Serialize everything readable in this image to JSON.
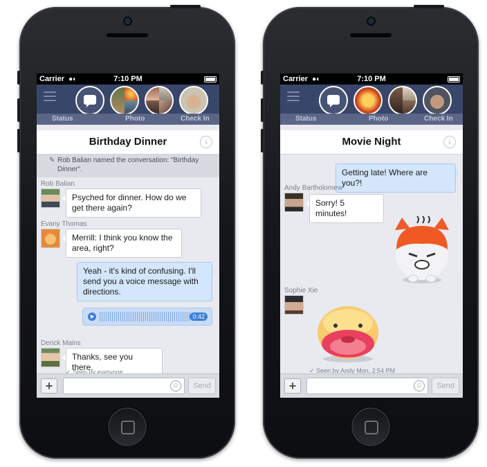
{
  "status_bar": {
    "carrier": "Carrier",
    "time": "7:10 PM"
  },
  "fb_bar": {
    "status": "Status",
    "photo": "Photo",
    "check_in": "Check In"
  },
  "composer": {
    "send": "Send",
    "plus": "+"
  },
  "left_phone": {
    "title": "Birthday Dinner",
    "notice": "Rob Balian named the conversation: \"Birthday Dinner\".",
    "messages": [
      {
        "sender": "Rob Balian",
        "text": "Psyched for dinner. How do we get there again?"
      },
      {
        "sender": "Evany Thomas",
        "text": "Merrill: I think you know the area, right?"
      },
      {
        "sender": "",
        "text": "Yeah - it's kind of confusing. I'll send you a voice message with directions."
      },
      {
        "sender": "Derick Mains",
        "text": "Thanks, see you there."
      }
    ],
    "voice_duration": "0:42",
    "seen": "Seen by everyone"
  },
  "right_phone": {
    "title": "Movie Night",
    "messages": [
      {
        "sender": "",
        "text": "Getting late! Where are you?!"
      },
      {
        "sender": "Andy Bartholomew",
        "text": "Sorry! 5 minutes!"
      },
      {
        "sender": "Sophie Xie",
        "text": ""
      }
    ],
    "seen": "Seen by Andy Mon, 2:54 PM"
  },
  "colors": {
    "chathead_bar": "#38466a",
    "outgoing_bubble": "#d4e6fb",
    "incoming_bubble": "#ffffff",
    "voice_accent": "#3d7ed8"
  },
  "icons": [
    "menu-icon",
    "messenger-icon",
    "info-icon",
    "pencil-icon",
    "play-icon",
    "smiley-icon",
    "wifi-icon",
    "battery-icon",
    "checkmark-icon"
  ]
}
